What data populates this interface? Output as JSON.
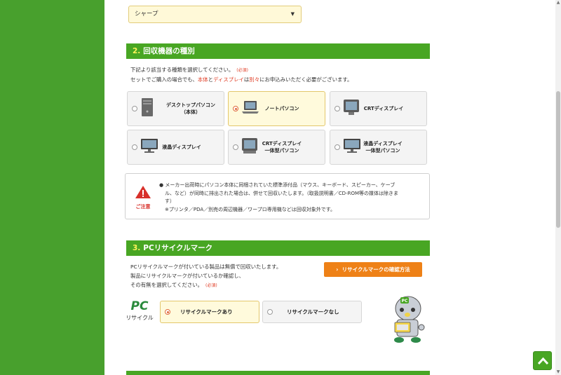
{
  "maker_select": {
    "value": "シャープ"
  },
  "section2": {
    "number": "2.",
    "title": "回収機器の種別",
    "desc_line1": "下記より該当する種類を選択してください。",
    "required": "(必須)",
    "desc_line2_a": "セットでご購入の場合でも、",
    "desc_line2_b": "本体",
    "desc_line2_c": "と",
    "desc_line2_d": "ディスプレイ",
    "desc_line2_e": "は",
    "desc_line2_f": "別々",
    "desc_line2_g": "にお申込みいただく必要がございます。",
    "options": [
      {
        "line1": "デスクトップパソコン",
        "line2": "（本体）",
        "selected": false,
        "icon": "desktop-tower-icon"
      },
      {
        "line1": "ノートパソコン",
        "line2": "",
        "selected": true,
        "icon": "laptop-icon"
      },
      {
        "line1": "CRTディスプレイ",
        "line2": "",
        "selected": false,
        "icon": "crt-monitor-icon"
      },
      {
        "line1": "液晶ディスプレイ",
        "line2": "",
        "selected": false,
        "icon": "lcd-monitor-icon"
      },
      {
        "line1": "CRTディスプレイ",
        "line2": "一体型パソコン",
        "selected": false,
        "icon": "crt-all-in-one-icon"
      },
      {
        "line1": "液晶ディスプレイ",
        "line2": "一体型パソコン",
        "selected": false,
        "icon": "lcd-all-in-one-icon"
      }
    ]
  },
  "caution": {
    "label": "ご注意",
    "bullet": "●",
    "line1": "メーカー出荷時にパソコン本体に同梱されていた標準添付品（マウス、キーボード、スピーカー、ケーブ",
    "line2": "ル、など）が同時に排出された場合は、併せて回収いたします。（取扱説明書／CD-ROM等の媒体は除きま",
    "line3": "す）",
    "line4": "※プリンタ／PDA／別売の周辺機器／ワープロ専用機などは回収対象外です。"
  },
  "section3": {
    "number": "3.",
    "title": "PCリサイクルマーク",
    "desc_line1": "PCリサイクルマークが付いている製品は無償で回収いたします。",
    "desc_line2": "製品にリサイクルマークが付いているか確認し、",
    "desc_line3": "その有無を選択してください。",
    "required": "(必須)",
    "check_button": "リサイクルマークの確認方法",
    "logo_text": "PC",
    "logo_sub": "リサイクル",
    "mascot_badge": "PC",
    "options": [
      {
        "label": "リサイクルマークあり",
        "selected": true
      },
      {
        "label": "リサイクルマークなし",
        "selected": false
      }
    ]
  },
  "colors": {
    "brand_green": "#48a623",
    "accent_orange": "#ee8117",
    "selected_bg": "#fffadc",
    "warning_red": "#d8302a"
  }
}
